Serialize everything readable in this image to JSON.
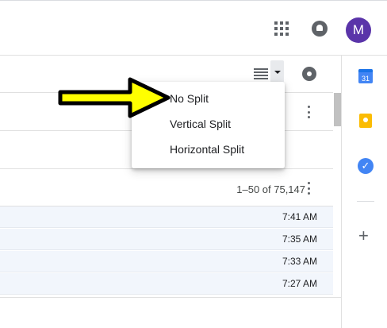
{
  "topbar": {
    "avatar_letter": "M",
    "apps_icon": "apps-grid-icon",
    "notifications_icon": "bell-icon"
  },
  "toolbar": {
    "density_icon": "list-density-icon",
    "split_dropdown_icon": "caret-down-icon",
    "settings_icon": "gear-icon"
  },
  "split_menu": {
    "items": [
      "No Split",
      "Vertical Split",
      "Horizontal Split"
    ]
  },
  "pagination": {
    "label": "1–50 of 75,147"
  },
  "emails": [
    {
      "time": "7:41 AM"
    },
    {
      "time": "7:35 AM"
    },
    {
      "time": "7:33 AM"
    },
    {
      "time": "7:27 AM"
    }
  ],
  "side_panel": {
    "calendar_day": "31",
    "tasks_check": "✓",
    "add_symbol": "+"
  },
  "colors": {
    "avatar": "#5a34a9",
    "arrow_fill": "#ffff00",
    "arrow_stroke": "#000000",
    "row_background": "#f2f6fc"
  }
}
